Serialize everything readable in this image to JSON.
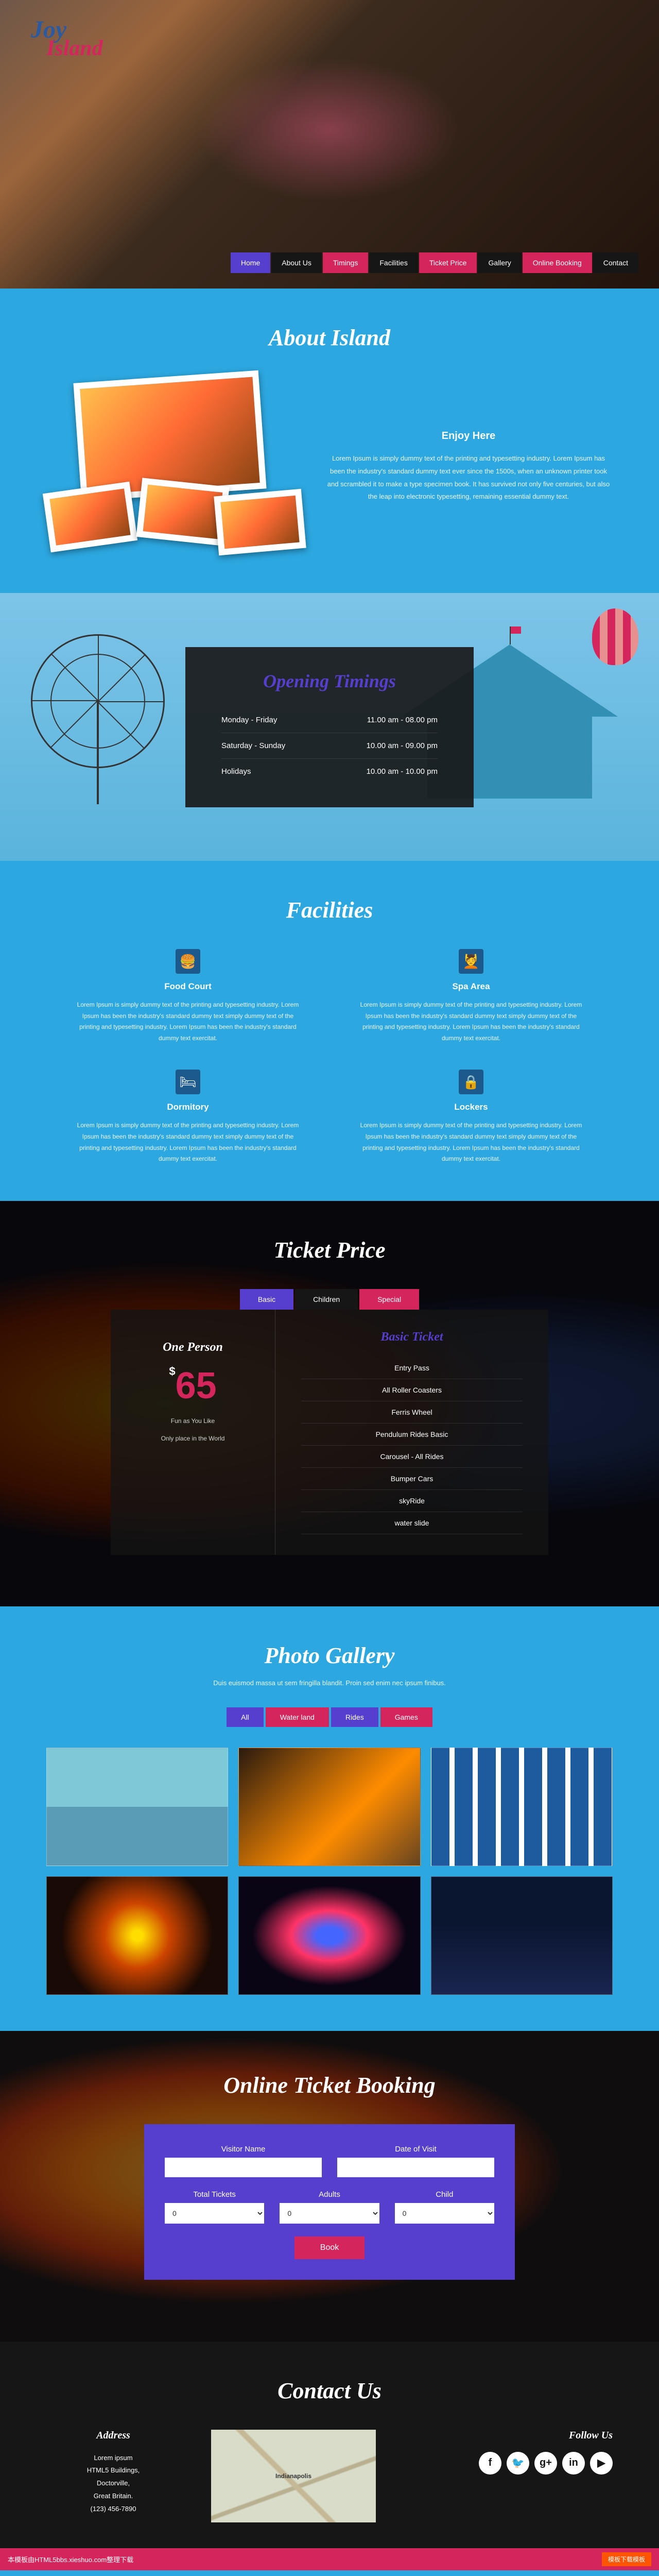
{
  "logo": {
    "top": "Joy",
    "bottom": "Island"
  },
  "nav": [
    {
      "label": "Home",
      "cls": "active"
    },
    {
      "label": "About Us",
      "cls": ""
    },
    {
      "label": "Timings",
      "cls": "red"
    },
    {
      "label": "Facilities",
      "cls": ""
    },
    {
      "label": "Ticket Price",
      "cls": "red"
    },
    {
      "label": "Gallery",
      "cls": ""
    },
    {
      "label": "Online Booking",
      "cls": "red"
    },
    {
      "label": "Contact",
      "cls": ""
    }
  ],
  "about": {
    "heading": "About Island",
    "subheading": "Enjoy Here",
    "text": "Lorem Ipsum is simply dummy text of the printing and typesetting industry. Lorem Ipsum has been the industry's standard dummy text ever since the 1500s, when an unknown printer took and scrambled it to make a type specimen book. It has survived not only five centuries, but also the leap into electronic typesetting, remaining essential dummy text."
  },
  "timings": {
    "heading": "Opening Timings",
    "rows": [
      {
        "days": "Monday - Friday",
        "hours": "11.00 am - 08.00 pm"
      },
      {
        "days": "Saturday - Sunday",
        "hours": "10.00 am - 09.00 pm"
      },
      {
        "days": "Holidays",
        "hours": "10.00 am - 10.00 pm"
      }
    ]
  },
  "facilities": {
    "heading": "Facilities",
    "items": [
      {
        "icon": "🍔",
        "title": "Food Court",
        "desc": "Lorem Ipsum is simply dummy text of the printing and typesetting industry. Lorem Ipsum has been the industry's standard dummy text simply dummy text of the printing and typesetting industry. Lorem Ipsum has been the industry's standard dummy text exercitat."
      },
      {
        "icon": "💆",
        "title": "Spa Area",
        "desc": "Lorem Ipsum is simply dummy text of the printing and typesetting industry. Lorem Ipsum has been the industry's standard dummy text simply dummy text of the printing and typesetting industry. Lorem Ipsum has been the industry's standard dummy text exercitat."
      },
      {
        "icon": "🛏",
        "title": "Dormitory",
        "desc": "Lorem Ipsum is simply dummy text of the printing and typesetting industry. Lorem Ipsum has been the industry's standard dummy text simply dummy text of the printing and typesetting industry. Lorem Ipsum has been the industry's standard dummy text exercitat."
      },
      {
        "icon": "🔒",
        "title": "Lockers",
        "desc": "Lorem Ipsum is simply dummy text of the printing and typesetting industry. Lorem Ipsum has been the industry's standard dummy text simply dummy text of the printing and typesetting industry. Lorem Ipsum has been the industry's standard dummy text exercitat."
      }
    ]
  },
  "ticket": {
    "heading": "Ticket Price",
    "tabs": [
      {
        "label": "Basic",
        "cls": "t-active"
      },
      {
        "label": "Children",
        "cls": ""
      },
      {
        "label": "Special",
        "cls": "t-red"
      }
    ],
    "person": "One Person",
    "currency": "$",
    "price": "65",
    "tag1": "Fun as You Like",
    "tag2": "Only place in the World",
    "list_title": "Basic Ticket",
    "items": [
      "Entry Pass",
      "All Roller Coasters",
      "Ferris Wheel",
      "Pendulum Rides Basic",
      "Carousel - All Rides",
      "Bumper Cars",
      "skyRide",
      "water slide"
    ]
  },
  "gallery": {
    "heading": "Photo Gallery",
    "sub": "Duis euismod massa ut sem fringilla blandit. Proin sed enim nec ipsum finibus.",
    "filters": [
      {
        "label": "All",
        "cls": ""
      },
      {
        "label": "Water land",
        "cls": "f-red"
      },
      {
        "label": "Rides",
        "cls": ""
      },
      {
        "label": "Games",
        "cls": "f-red"
      }
    ]
  },
  "booking": {
    "heading": "Online Ticket Booking",
    "labels": {
      "name": "Visitor Name",
      "date": "Date of Visit",
      "total": "Total Tickets",
      "adults": "Adults",
      "child": "Child"
    },
    "placeholders": {
      "name": "",
      "date": ""
    },
    "options": {
      "total": "0",
      "adults": "0",
      "child": "0"
    },
    "button": "Book"
  },
  "contact": {
    "heading": "Contact Us",
    "address_title": "Address",
    "address": "Lorem ipsum\nHTML5 Buildings,\nDoctorville,\nGreat Britain.\n(123) 456-7890",
    "map_label": "Indianapolis",
    "follow_title": "Follow Us",
    "social": [
      "f",
      "t",
      "g",
      "in",
      "yt"
    ]
  },
  "footer": {
    "left": "本模板由HTML5bbs.xieshuo.com整理下载",
    "right": "模板下载模板"
  }
}
